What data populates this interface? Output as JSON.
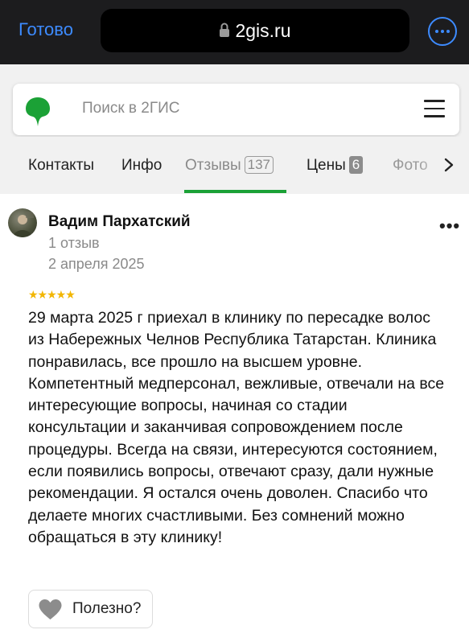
{
  "browser": {
    "done_label": "Готово",
    "url": "2gis.ru",
    "accent": "#3d8bff"
  },
  "search": {
    "placeholder": "Поиск в 2ГИС",
    "logo_color": "#1ba136"
  },
  "tabs": [
    {
      "label": "Контакты"
    },
    {
      "label": "Инфо"
    },
    {
      "label": "Отзывы",
      "count": "137",
      "active": true
    },
    {
      "label": "Цены",
      "count": "6"
    },
    {
      "label": "Фото"
    }
  ],
  "review": {
    "author": "Вадим Пархатский",
    "reviews_count": "1 отзыв",
    "date": "2 апреля 2025",
    "rating": 5,
    "stars": "★★★★★",
    "text": "29 марта 2025 г приехал в клинику по пересадке волос из Набережных Челнов Республика Татарстан. Клиника понравилась, все прошло на высшем уровне. Компетентный медперсонал, вежливые, отвечали на все интересующие вопросы, начиная со стадии консультации и заканчивая сопровождением после процедуры. Всегда на связи, интересуются состоянием, если появились вопросы, отвечают сразу, дали нужные рекомендации. Я остался очень доволен. Спасибо что делаете многих счастливыми. Без сомнений можно обращаться в эту клинику!",
    "helpful_label": "Полезно?"
  },
  "icons": {
    "lock": "lock-icon",
    "more": "more-icon",
    "logo": "2gis-logo-icon",
    "menu": "hamburger-menu-icon",
    "chevron": "chevron-right-icon",
    "dots": "more-dots-icon",
    "heart": "heart-icon"
  }
}
